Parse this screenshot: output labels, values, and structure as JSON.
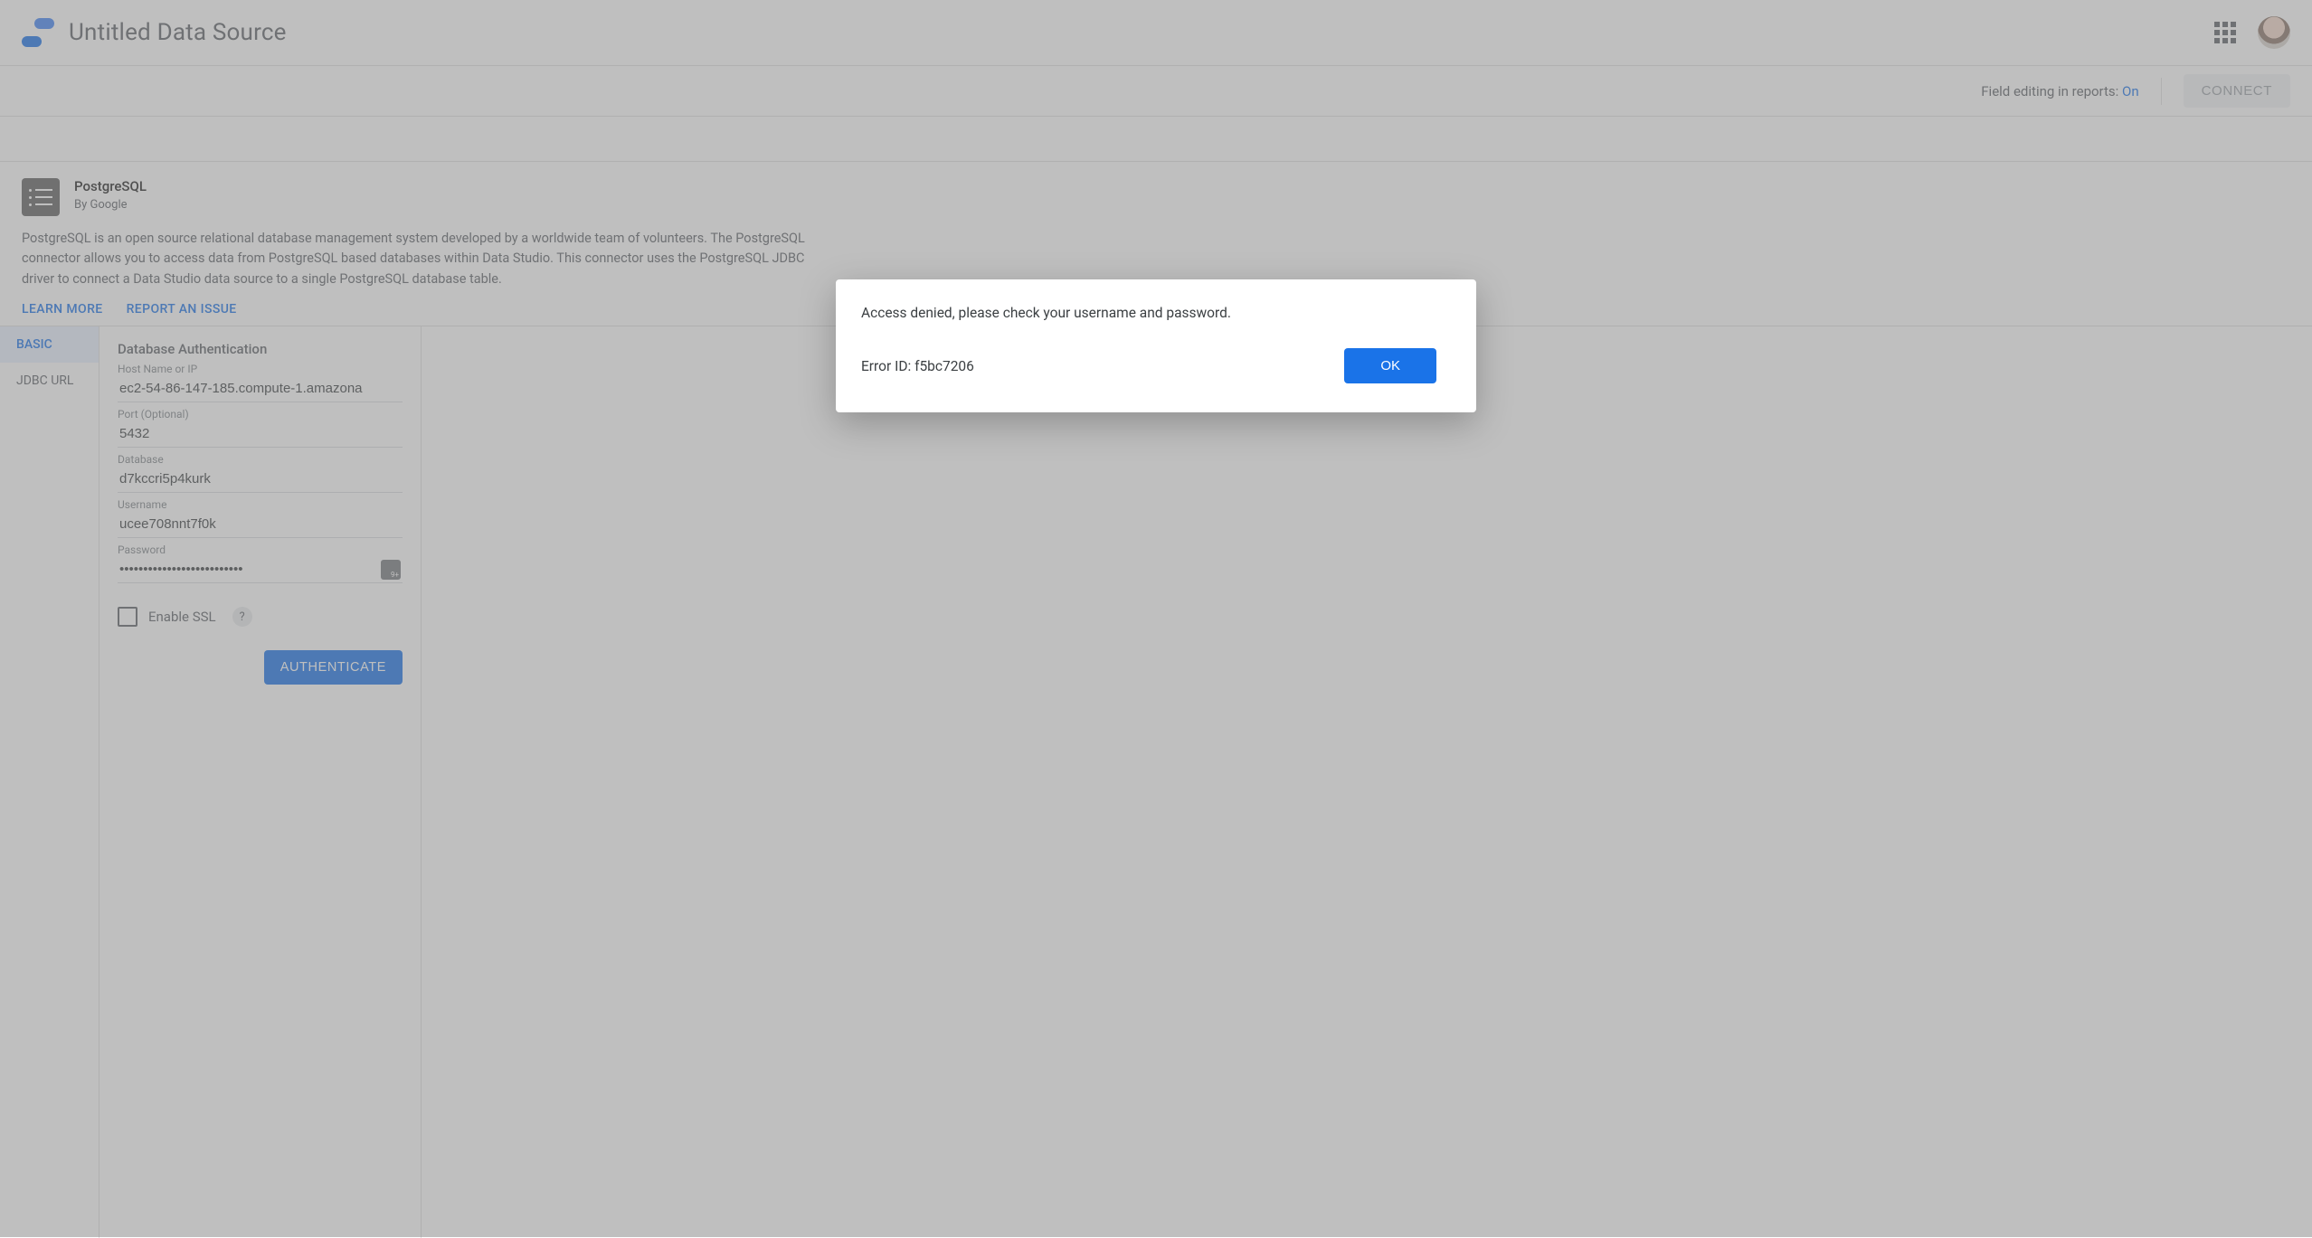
{
  "header": {
    "title": "Untitled Data Source"
  },
  "action_bar": {
    "field_editing_label": "Field editing in reports:",
    "field_editing_value": "On",
    "connect_label": "CONNECT"
  },
  "connector": {
    "name": "PostgreSQL",
    "by": "By Google",
    "description": "PostgreSQL is an open source relational database management system developed by a worldwide team of volunteers. The PostgreSQL connector allows you to access data from PostgreSQL based databases within Data Studio. This connector uses the PostgreSQL JDBC driver to connect a Data Studio data source to a single PostgreSQL database table.",
    "learn_more": "LEARN MORE",
    "report_issue": "REPORT AN ISSUE"
  },
  "tabs": {
    "basic": "BASIC",
    "jdbc": "JDBC URL"
  },
  "form": {
    "title": "Database Authentication",
    "host_label": "Host Name or IP",
    "host_value": "ec2-54-86-147-185.compute-1.amazona",
    "port_label": "Port (Optional)",
    "port_value": "5432",
    "database_label": "Database",
    "database_value": "d7kccri5p4kurk",
    "username_label": "Username",
    "username_value": "ucee708nnt7f0k",
    "password_label": "Password",
    "password_value": "••••••••••••••••••••••••••",
    "enable_ssl_label": "Enable SSL",
    "help_symbol": "?",
    "authenticate_label": "AUTHENTICATE"
  },
  "dialog": {
    "message": "Access denied, please check your username and password.",
    "error_id": "Error ID: f5bc7206",
    "ok_label": "OK"
  }
}
